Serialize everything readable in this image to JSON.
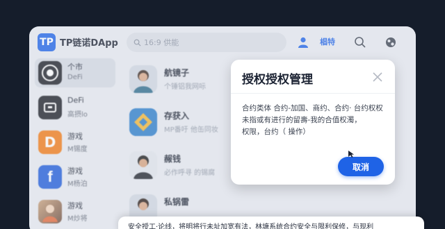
{
  "app": {
    "logo_text": "TP",
    "title": "TP链诺DApp"
  },
  "search": {
    "placeholder": "16:9 供能"
  },
  "topbar": {
    "badge_label": "椙特"
  },
  "sidebar": {
    "items": [
      {
        "line1": "个市",
        "line2": "DeFi",
        "icon": "coin-icon",
        "color": "#1b1e26"
      },
      {
        "line1": "DeFi",
        "line2": "高摂lo",
        "icon": "wallet-icon",
        "color": "#1b1e26"
      },
      {
        "line1": "游戏",
        "line2": "M锡度",
        "icon": "d-logo-icon",
        "color": "#f07a16"
      },
      {
        "line1": "游戏",
        "line2": "M杨泊",
        "icon": "facebook-icon",
        "color": "#1f5bd8"
      },
      {
        "line1": "游戏",
        "line2": "M炒将",
        "icon": "game-avatar-icon",
        "color": "#9b6a4a"
      }
    ]
  },
  "list": {
    "items": [
      {
        "title": "航镜子",
        "subtitle": "个锤铝我网呩",
        "icon": "person-avatar-icon"
      },
      {
        "title": "存获入",
        "subtitle": "MP番吁 他缶同妆",
        "icon": "diamond-icon"
      },
      {
        "title": "赧钱",
        "subtitle": "必作呼寻 的锡腐",
        "icon": "person-avatar-icon"
      },
      {
        "title": "私锅雷",
        "subtitle": "",
        "icon": "person-avatar-icon"
      }
    ]
  },
  "dialog": {
    "title": "授权授权管理",
    "body_line1": "合约类体 合约-加国、商约、合约· 台约权权",
    "body_line2": "未指或有进行的留壽-我的合值权濁，",
    "body_line3": "权限，台约（ 操作）",
    "cancel_label": "取消"
  },
  "bottom": {
    "text": "安全授工·论线，将明将行未址加宽有法，林塘系统合约安全与限利保修，与现利"
  },
  "colors": {
    "accent": "#1f63e6",
    "background": "#151d2b",
    "window": "#e6e9ef"
  }
}
